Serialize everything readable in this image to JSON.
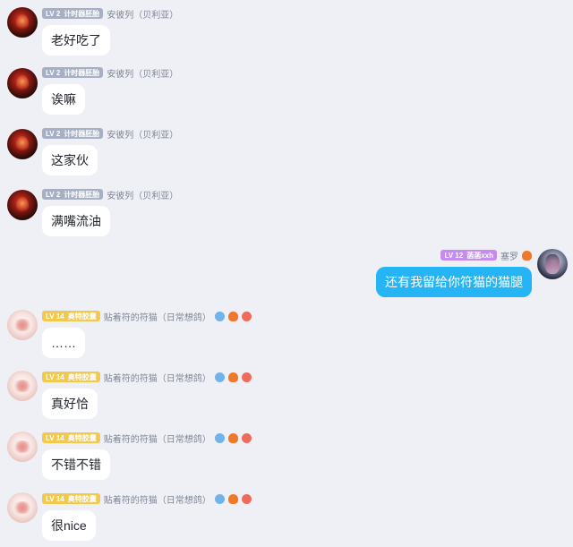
{
  "messages": [
    {
      "badge_level": "LV 2",
      "badge_title": "计时器胚胎",
      "username": "安彼列（贝利亚）",
      "text": "老好吃了"
    },
    {
      "badge_level": "LV 2",
      "badge_title": "计时器胚胎",
      "username": "安彼列（贝利亚）",
      "text": "诶嘛"
    },
    {
      "badge_level": "LV 2",
      "badge_title": "计时器胚胎",
      "username": "安彼列（贝利亚）",
      "text": "这家伙"
    },
    {
      "badge_level": "LV 2",
      "badge_title": "计时器胚胎",
      "username": "安彼列（贝利亚）",
      "text": "满嘴流油"
    },
    {
      "badge_level": "LV 12",
      "badge_title": "菡菡xxh",
      "username": "塞罗",
      "text": "还有我留给你符猫的猫腿"
    },
    {
      "badge_level": "LV 14",
      "badge_title": "奥特胶囊",
      "username": "贴着符的符猫（日常想鸽）",
      "text": "……"
    },
    {
      "badge_level": "LV 14",
      "badge_title": "奥特胶囊",
      "username": "贴着符的符猫（日常想鸽）",
      "text": "真好恰"
    },
    {
      "badge_level": "LV 14",
      "badge_title": "奥特胶囊",
      "username": "贴着符的符猫（日常想鸽）",
      "text": "不错不错"
    },
    {
      "badge_level": "LV 14",
      "badge_title": "奥特胶囊",
      "username": "贴着符的符猫（日常想鸽）",
      "text": "很nice"
    }
  ],
  "icons": {
    "user_dark": [
      "bird-icon",
      "fire-icon",
      "flower-icon"
    ],
    "self": [
      "fire-icon"
    ]
  },
  "colors": {
    "background": "#eef0f6",
    "self_bubble": "#25b4f4",
    "badge_lv2": "#a6afc4",
    "badge_lv14": "#f2c94c",
    "badge_lv12": "#c58bf0"
  }
}
